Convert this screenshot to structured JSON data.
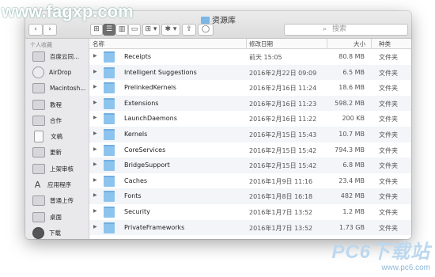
{
  "watermark_top": "www.fagxp.com",
  "watermark_bottom": {
    "big": "PC6下载站",
    "small": "www.pc6.com"
  },
  "window": {
    "title": "资源库"
  },
  "toolbar": {
    "back": "‹",
    "forward": "›",
    "view_icons": "⊞",
    "view_list": "☰",
    "view_columns": "▥",
    "view_cover": "▭",
    "arrange": "⊞ ▾",
    "action": "✱ ▾",
    "share": "⇪",
    "tags": "◯",
    "search_placeholder": "搜索"
  },
  "sidebar": {
    "section": "个人收藏",
    "items": [
      {
        "label": "百度云同...",
        "icon": "folder-icon"
      },
      {
        "label": "AirDrop",
        "icon": "airdrop-icon"
      },
      {
        "label": "Macintosh...",
        "icon": "hard-drive-icon"
      },
      {
        "label": "教程",
        "icon": "folder-icon"
      },
      {
        "label": "合作",
        "icon": "folder-icon"
      },
      {
        "label": "文稿",
        "icon": "document-icon"
      },
      {
        "label": "更新",
        "icon": "folder-icon"
      },
      {
        "label": "上架审核",
        "icon": "folder-icon"
      },
      {
        "label": "应用程序",
        "icon": "applications-icon"
      },
      {
        "label": "普通上传",
        "icon": "folder-icon"
      },
      {
        "label": "桌面",
        "icon": "desktop-icon"
      },
      {
        "label": "下载",
        "icon": "downloads-icon"
      }
    ]
  },
  "columns": {
    "name": "名称",
    "date": "修改日期",
    "size": "大小",
    "kind": "种类"
  },
  "rows": [
    {
      "name": "Receipts",
      "date": "前天 15:05",
      "size": "80.8 MB",
      "kind": "文件夹"
    },
    {
      "name": "Intelligent Suggestions",
      "date": "2016年2月22日 09:09",
      "size": "6.5 MB",
      "kind": "文件夹"
    },
    {
      "name": "PrelinkedKernels",
      "date": "2016年2月16日 11:24",
      "size": "18.6 MB",
      "kind": "文件夹"
    },
    {
      "name": "Extensions",
      "date": "2016年2月16日 11:23",
      "size": "598.2 MB",
      "kind": "文件夹"
    },
    {
      "name": "LaunchDaemons",
      "date": "2016年2月16日 11:22",
      "size": "200 KB",
      "kind": "文件夹"
    },
    {
      "name": "Kernels",
      "date": "2016年2月15日 15:43",
      "size": "10.7 MB",
      "kind": "文件夹"
    },
    {
      "name": "CoreServices",
      "date": "2016年2月15日 15:42",
      "size": "794.3 MB",
      "kind": "文件夹"
    },
    {
      "name": "BridgeSupport",
      "date": "2016年2月15日 15:42",
      "size": "6.8 MB",
      "kind": "文件夹"
    },
    {
      "name": "Caches",
      "date": "2016年1月9日 11:16",
      "size": "23.4 MB",
      "kind": "文件夹"
    },
    {
      "name": "Fonts",
      "date": "2016年1月8日 16:18",
      "size": "482 MB",
      "kind": "文件夹"
    },
    {
      "name": "Security",
      "date": "2016年1月7日 13:52",
      "size": "1.2 MB",
      "kind": "文件夹"
    },
    {
      "name": "PrivateFrameworks",
      "date": "2016年1月7日 13:52",
      "size": "1.73 GB",
      "kind": "文件夹"
    }
  ]
}
